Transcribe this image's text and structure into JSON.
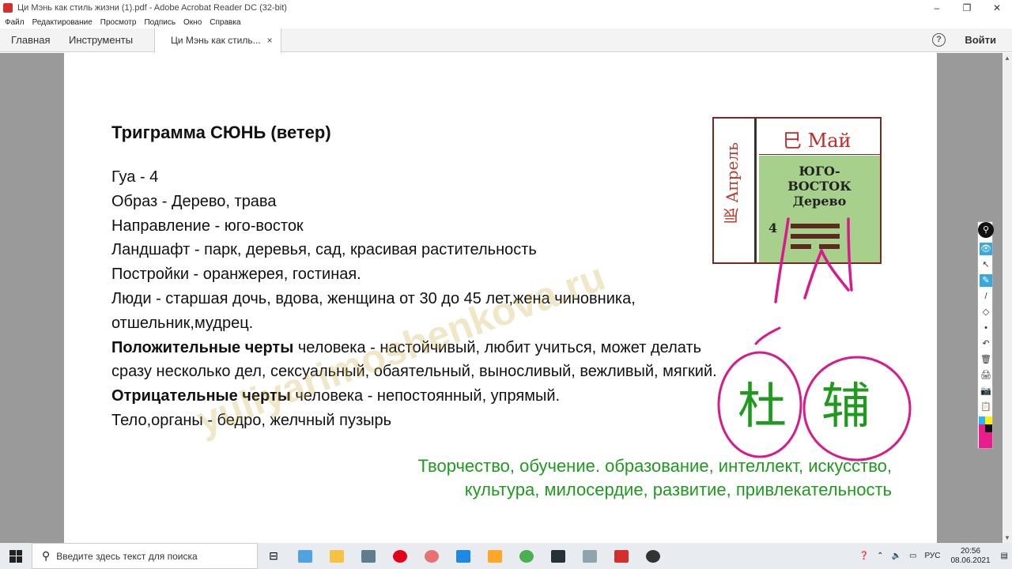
{
  "window": {
    "title": "Ци Мэнь как стиль жизни (1).pdf - Adobe Acrobat Reader DC (32-bit)",
    "controls": [
      "–",
      "❐",
      "✕"
    ]
  },
  "menu": [
    "Файл",
    "Редактирование",
    "Просмотр",
    "Подпись",
    "Окно",
    "Справка"
  ],
  "tabs": {
    "home": "Главная",
    "tools": "Инструменты",
    "doc": "Ци Мэнь как стиль...",
    "close": "×",
    "help": "?",
    "login": "Войти"
  },
  "document": {
    "heading": "Триграмма СЮНЬ (ветер)",
    "lines": {
      "gua": "Гуа - 4",
      "image": "Образ - Дерево, трава",
      "direction": "Направление - юго-восток",
      "landscape": "Ландшафт - парк, деревья, сад, красивая растительность",
      "buildings": "Постройки - оранжерея, гостиная.",
      "people": "Люди - старшая дочь, вдова, женщина от 30 до 45 лет,жена чиновника, отшельник,мудрец.",
      "positive_label": "Положительные черты",
      "positive_text": " человека - настойчивый, любит учиться, может делать сразу несколько дел, сексуальный, обаятельный, выносливый, вежливый, мягкий.",
      "negative_label": "Отрицательные черты",
      "negative_text": " человека - непостоянный, упрямый.",
      "body": "Тело,органы  - бедро, желчный пузырь"
    },
    "green_text": "Творчество, обучение. образование, интеллект, искусство, культура, милосердие, развитие, привлекательность",
    "watermark": "yuliyarimoshenkova.ru",
    "bagua": {
      "month_left": "辰 Апрель",
      "month_top": "巳 Май",
      "direction_line1": "ЮГО-",
      "direction_line2": "ВОСТОК",
      "element": "Дерево",
      "number": "4"
    },
    "annotation_chars": [
      "杜",
      "辅"
    ]
  },
  "drawbar": {
    "pin": "⚲",
    "tools": [
      "👁",
      "↖",
      "✎",
      "/",
      "◇",
      "•",
      "↶",
      "🗑",
      "🖨",
      "📷",
      "📋"
    ]
  },
  "taskbar": {
    "search_placeholder": "Введите здесь текст для поиска",
    "lang": "РУС",
    "time": "20:56",
    "date": "08.06.2021"
  },
  "colors": {
    "annotation": "#d81b8a",
    "green_text": "#1f9a1f",
    "green_cell": "#a8d08d"
  }
}
